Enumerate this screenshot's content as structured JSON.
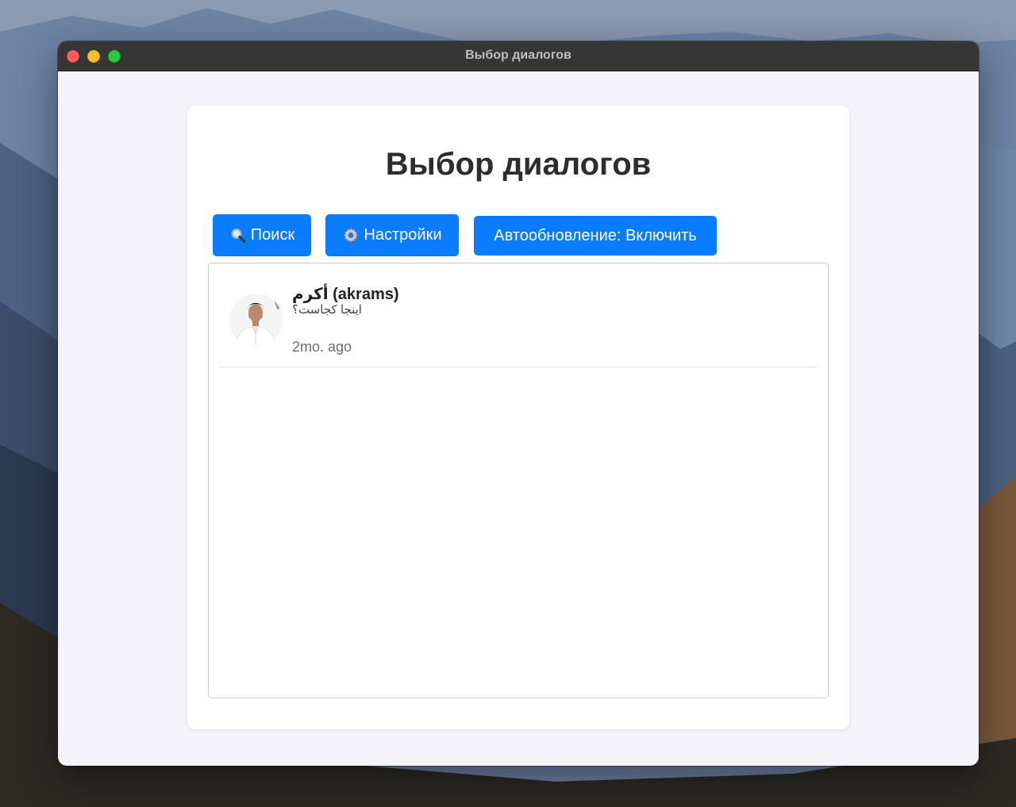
{
  "window": {
    "title": "Выбор диалогов"
  },
  "page": {
    "title": "Выбор диалогов"
  },
  "toolbar": {
    "search_label": "Поиск",
    "search_icon": "magnifier-icon",
    "settings_label": "Настройки",
    "settings_icon": "gear-icon",
    "auto_refresh_label": "Автообновление: Включить"
  },
  "dialogs": [
    {
      "name": "أكرم (akrams)",
      "message": "اینجا کجاست؟",
      "time": "2mo. ago",
      "avatar": "avatar-photo"
    }
  ],
  "colors": {
    "accent": "#0a7cff",
    "titlebar": "#363636",
    "background": "#f3f3f9"
  }
}
